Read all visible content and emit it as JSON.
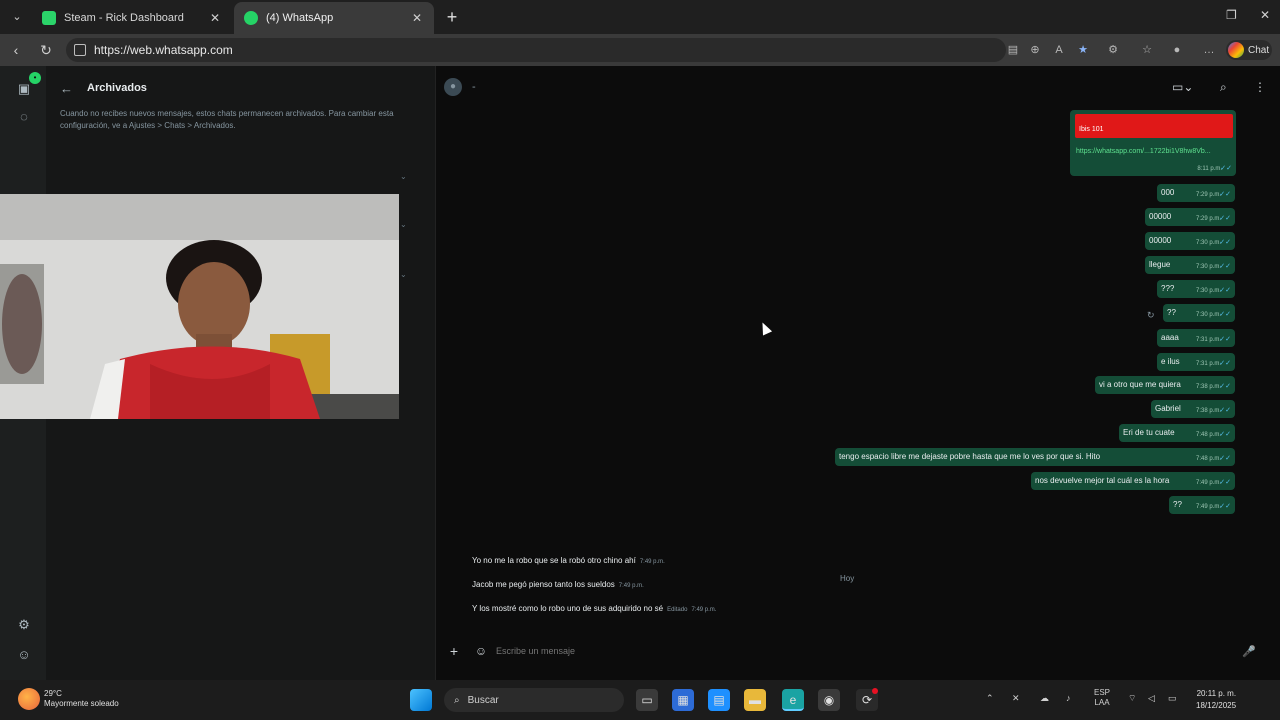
{
  "browser": {
    "tabs": [
      {
        "title": "Steam - Rick Dashboard",
        "favicon_color": "#2bd46a"
      },
      {
        "title": "(4) WhatsApp",
        "favicon_color": "#25d366"
      }
    ],
    "url": "https://web.whatsapp.com",
    "profile_label": "Chat"
  },
  "sidebar": {
    "title": "Archivados",
    "description": "Cuando no recibes nuevos mensajes, estos chats permanecen archivados. Para cambiar esta configuración, ve a Ajustes > Chats > Archivados."
  },
  "chat": {
    "header_placeholder": "-",
    "media_message": {
      "label": "Ibis 101",
      "caption": "https://whatsapp.com/...1722bi1V8hw8Vb...",
      "time": "8:11 p.m."
    },
    "outgoing": [
      {
        "text": "000",
        "time": "7:29 p.m."
      },
      {
        "text": "00000",
        "time": "7:29 p.m."
      },
      {
        "text": "00000",
        "time": "7:30 p.m."
      },
      {
        "text": "llegue",
        "time": "7:30 p.m."
      },
      {
        "text": "???",
        "time": "7:30 p.m."
      },
      {
        "text": "??",
        "time": "7:30 p.m."
      },
      {
        "text": "aaaa",
        "time": "7:31 p.m."
      },
      {
        "text": "e ilus",
        "time": "7:31 p.m."
      },
      {
        "text": "vi a otro que me quiera",
        "time": "7:38 p.m."
      },
      {
        "text": "Gabriel",
        "time": "7:38 p.m."
      },
      {
        "text": "Eri de tu cuate",
        "time": "7:48 p.m."
      },
      {
        "text": "tengo espacio libre me dejaste pobre hasta que me lo ves por que si. Hito",
        "time": "7:48 p.m."
      },
      {
        "text": "nos devuelve mejor tal cuál es la hora",
        "time": "7:49 p.m."
      },
      {
        "text": "??",
        "time": "7:49 p.m."
      }
    ],
    "date_chip": "Hoy",
    "incoming": [
      {
        "text": "Yo no me la robo que se la robó otro chino ahí",
        "time": "7:49 p.m."
      },
      {
        "text": "Jacob me pegó pienso tanto los sueldos",
        "time": "7:49 p.m."
      },
      {
        "text": "Y los mostré como lo robo uno de sus adquirido no sé",
        "time": "7:49 p.m."
      }
    ],
    "incoming_last_tag": "Editado",
    "compose_placeholder": "Escribe un mensaje"
  },
  "taskbar": {
    "weather_temp": "29°C",
    "weather_desc": "Mayormente soleado",
    "search_placeholder": "Buscar",
    "lang_top": "ESP",
    "lang_bottom": "LAA",
    "time": "20:11 p. m.",
    "date": "18/12/2025"
  },
  "colors": {
    "outgoing_bubble": "#144d37",
    "read_tick": "#53bdeb",
    "accent": "#25d366"
  }
}
